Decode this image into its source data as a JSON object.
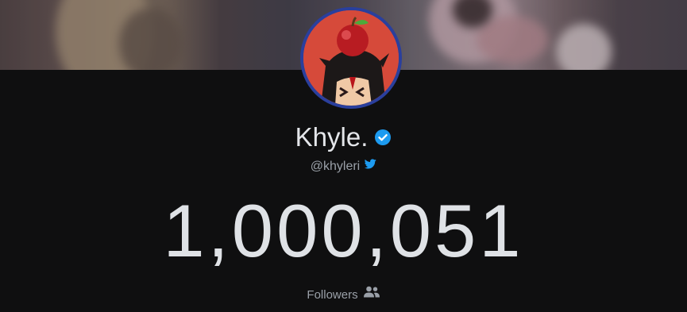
{
  "profile": {
    "display_name": "Khyle.",
    "handle": "@khyleri",
    "verified_icon": "verified-badge-icon",
    "platform_icon": "twitter-bird-icon"
  },
  "stats": {
    "followers_count": "1,000,051",
    "followers_label": "Followers",
    "followers_icon": "users-icon"
  },
  "colors": {
    "background": "#0f0f10",
    "avatar_border": "#2a3f9d",
    "verified": "#1d9bf0",
    "twitter": "#1d9bf0",
    "count_text": "#dfe2e6"
  }
}
